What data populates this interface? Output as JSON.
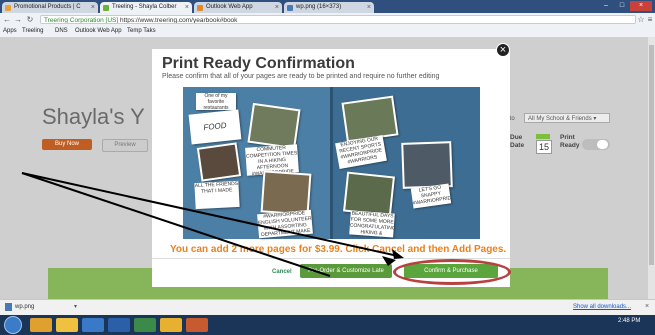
{
  "browser": {
    "tabs": [
      {
        "label": "Promotional Products | C"
      },
      {
        "label": "Treeling - Shayla Colber"
      },
      {
        "label": "Outlook Web App"
      },
      {
        "label": "wp.png (16×373)"
      }
    ],
    "address_secure_label": "Treering Corporation [US]",
    "address_url": "https://www.treering.com/yearbook#book",
    "bookmarks": [
      "Apps",
      "Treeling",
      "DNS",
      "Outlook Web App",
      "Temp Taks"
    ]
  },
  "background_page": {
    "title": "Shayla's Y",
    "buy_now_label": "Buy Now",
    "preview_label": "Preview",
    "share_label": "ble to",
    "share_value": "All My School & Friends",
    "due_label_1": "Due",
    "due_label_2": "Date",
    "due_number": "15",
    "print_label_1": "Print",
    "print_label_2": "Ready"
  },
  "modal": {
    "title": "Print Ready Confirmation",
    "subtitle": "Please confirm that all of your pages are ready to be printed and require no further editing",
    "upsell_text": "You can add 2 more pages for $3.99. Click Cancel and then Add Pages.",
    "cancel_label": "Cancel",
    "preorder_label": "Pre-Order & Customize Late",
    "confirm_label": "Confirm & Purchase",
    "close_symbol": "×",
    "book_captions": [
      "One of my favorite restaurants",
      "FOOD CARTS",
      "COMMUTER COMPETITION TIMES IN A HIKING AFTERNOON #WARRIORPRIDE",
      "ALL THE FRIENDS THAT I MADE",
      "ENJOYING OUR RECENT SPORTS #WARRIORPRIDE #WARRIORS",
      "#WARRIORPRIDE ENGLISH VOLUNTEER WITH ASSORTING DEPARTMENT MAKE STORY COVERED",
      "BEAUTIFUL DAYS FOR SOME MORE CONGRATULATING HIKING & CAMPING #WARRIORPRIDE",
      "LET'S GO SNAPPY #WARRIORPRIDE"
    ]
  },
  "download_bar": {
    "file_name": "wp.png",
    "show_all_label": "Show all downloads..."
  },
  "taskbar": {
    "time": "2:48 PM"
  },
  "colors": {
    "accent_orange": "#e8821e",
    "button_green": "#5aa53c",
    "annotation_red": "#b8403f"
  }
}
